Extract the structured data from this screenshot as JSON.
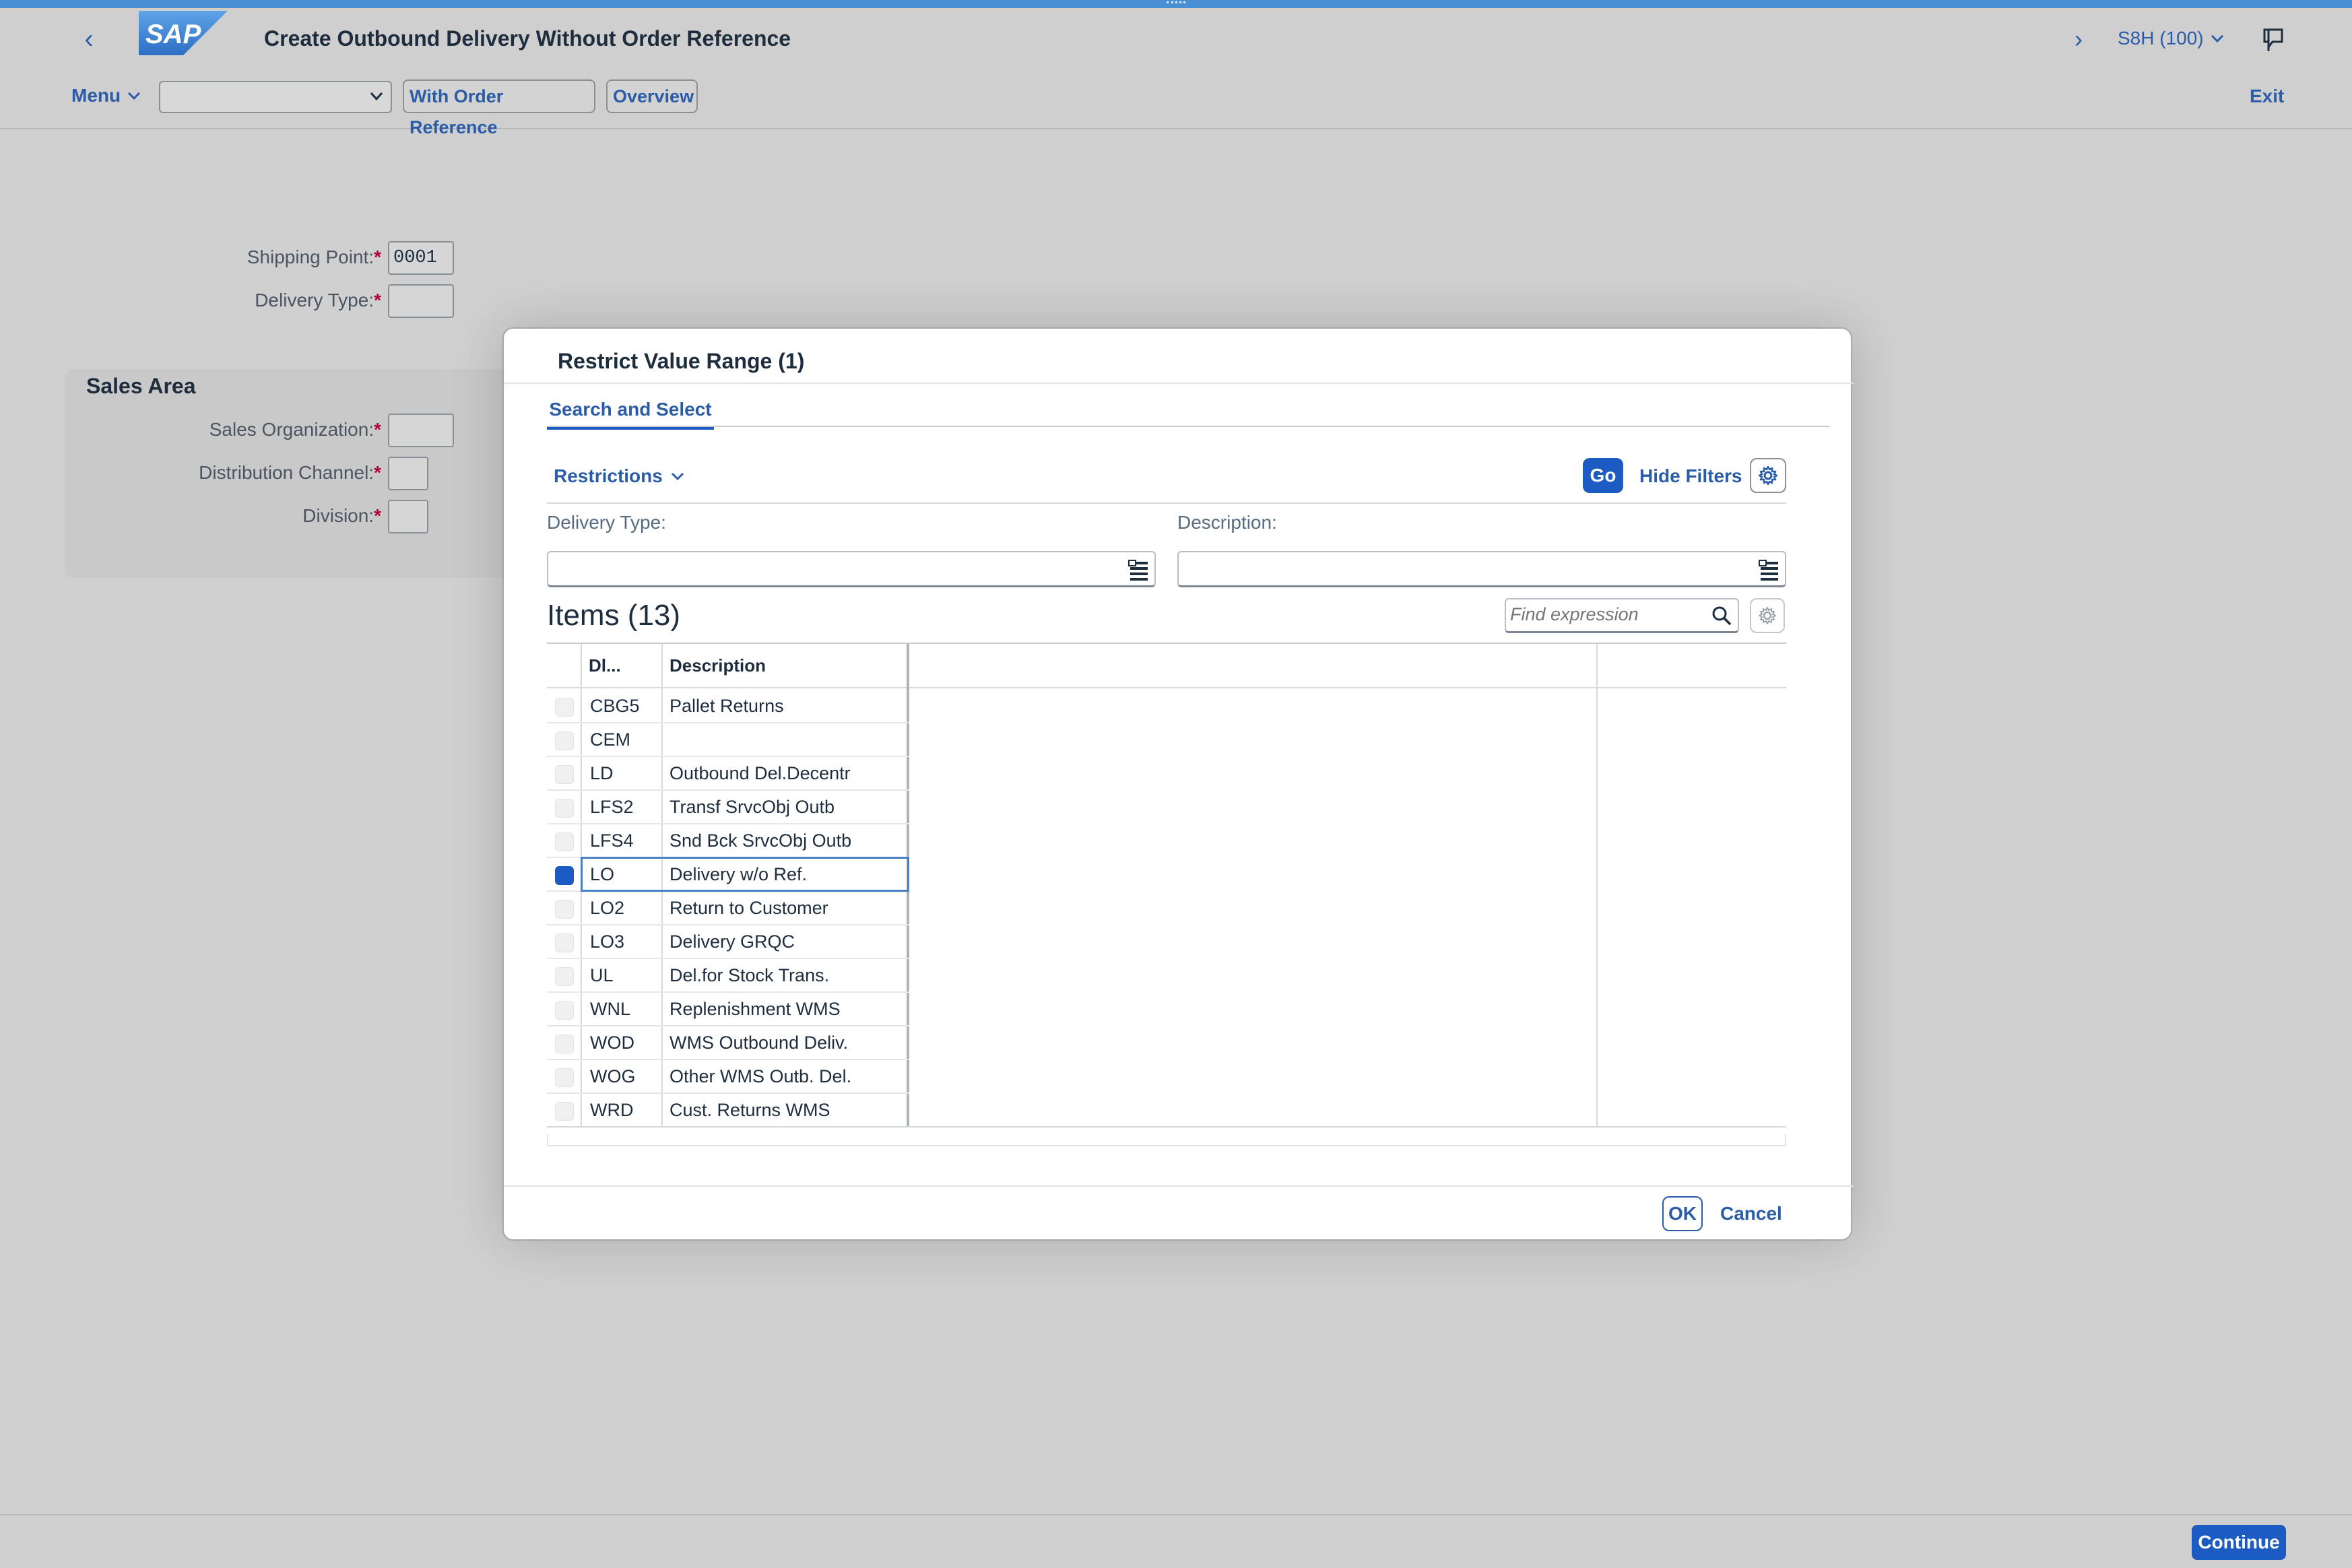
{
  "shell": {
    "title": "Create Outbound Delivery Without Order Reference",
    "logo_text": "SAP",
    "system": "S8H (100)",
    "icons": [
      "back-icon",
      "forward-icon",
      "chevron-down-icon",
      "feedback-icon"
    ]
  },
  "toolbar": {
    "menu_label": "Menu",
    "dropdown_value": "",
    "with_order_reference_label": "With Order Reference",
    "overview_label": "Overview",
    "exit_label": "Exit"
  },
  "form": {
    "shipping_point_label": "Shipping Point:",
    "shipping_point_value": "0001",
    "delivery_type_label": "Delivery Type:",
    "delivery_type_value": "",
    "sales_area_title": "Sales Area",
    "sales_org_label": "Sales Organization:",
    "sales_org_value": "",
    "dist_channel_label": "Distribution Channel:",
    "dist_channel_value": "",
    "division_label": "Division:",
    "division_value": "",
    "required_mark": "*"
  },
  "footer": {
    "continue_label": "Continue"
  },
  "dialog": {
    "title": "Restrict Value Range (1)",
    "tab_label": "Search and Select",
    "restrictions_label": "Restrictions",
    "go_label": "Go",
    "hide_filters_label": "Hide Filters",
    "filter_delivery_type_label": "Delivery Type:",
    "filter_delivery_type_value": "",
    "filter_description_label": "Description:",
    "filter_description_value": "",
    "items_title": "Items (13)",
    "find_placeholder": "Find expression",
    "columns": [
      "Dl...",
      "Description"
    ],
    "rows": [
      {
        "code": "CBG5",
        "description": "Pallet Returns",
        "selected": false
      },
      {
        "code": "CEM",
        "description": "",
        "selected": false
      },
      {
        "code": "LD",
        "description": "Outbound Del.Decentr",
        "selected": false
      },
      {
        "code": "LFS2",
        "description": "Transf SrvcObj Outb",
        "selected": false
      },
      {
        "code": "LFS4",
        "description": "Snd Bck SrvcObj Outb",
        "selected": false
      },
      {
        "code": "LO",
        "description": "Delivery w/o Ref.",
        "selected": true
      },
      {
        "code": "LO2",
        "description": "Return to Customer",
        "selected": false
      },
      {
        "code": "LO3",
        "description": "Delivery GRQC",
        "selected": false
      },
      {
        "code": "UL",
        "description": "Del.for Stock Trans.",
        "selected": false
      },
      {
        "code": "WNL",
        "description": "Replenishment WMS",
        "selected": false
      },
      {
        "code": "WOD",
        "description": "WMS Outbound Deliv.",
        "selected": false
      },
      {
        "code": "WOG",
        "description": "Other WMS Outb. Del.",
        "selected": false
      },
      {
        "code": "WRD",
        "description": "Cust. Returns WMS",
        "selected": false
      }
    ],
    "ok_label": "OK",
    "cancel_label": "Cancel"
  },
  "colors": {
    "accent": "#1c5bc1",
    "link": "#2a5ca8",
    "required": "#b3003b",
    "strip": "#4a8fd4"
  }
}
